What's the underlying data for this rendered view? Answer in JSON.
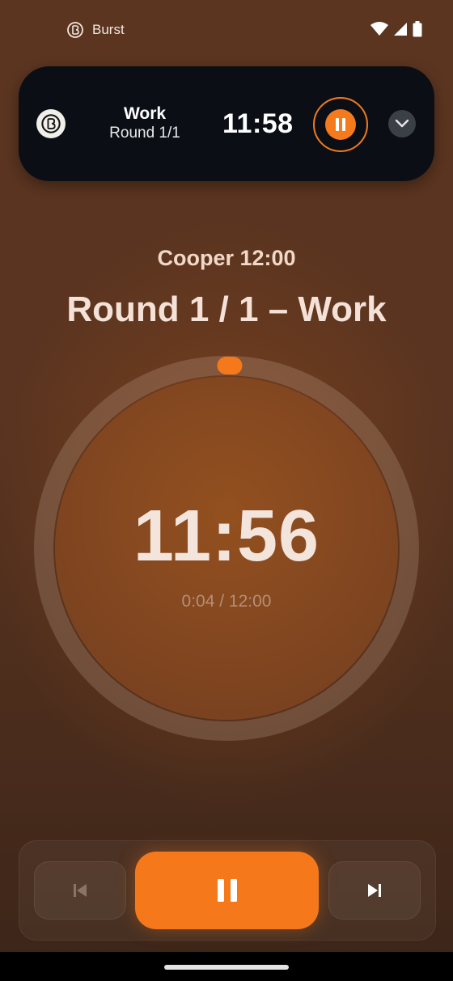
{
  "status_bar": {
    "app_name": "Burst",
    "icons": [
      "wifi-icon",
      "cellular-signal-icon",
      "battery-icon"
    ]
  },
  "mini_player": {
    "phase": "Work",
    "round": "Round 1/1",
    "time": "11:58",
    "icons": [
      "app-logo-icon",
      "pause-icon",
      "chevron-down-icon"
    ]
  },
  "workout": {
    "name": "Cooper 12:00",
    "round_title": "Round 1 / 1 – Work"
  },
  "timer": {
    "remaining": "11:56",
    "elapsed": "0:04 / 12:00",
    "progress_fraction": 0.0056
  },
  "controls": {
    "icons": [
      "skip-previous-icon",
      "pause-icon",
      "skip-next-icon"
    ]
  },
  "colors": {
    "accent": "#f5781b",
    "background": "#5a3420",
    "notification_bg": "#0b0f15"
  }
}
